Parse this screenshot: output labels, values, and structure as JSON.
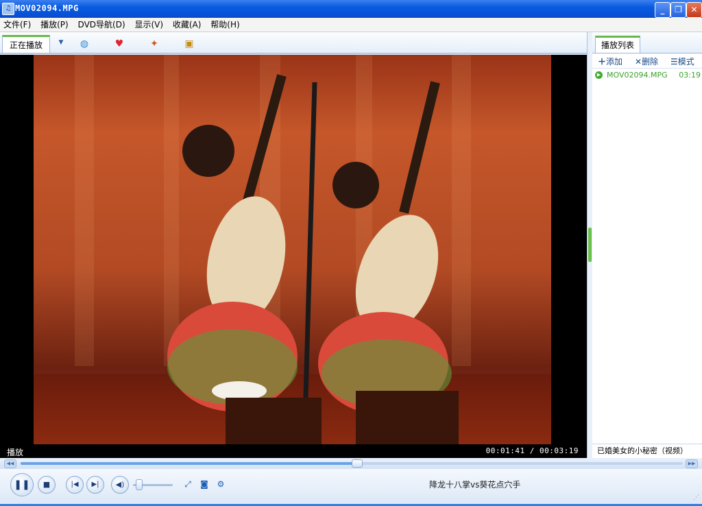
{
  "window": {
    "title": "MOV02094.MPG",
    "buttons": {
      "minimize": "_",
      "restore": "❐",
      "close": "✕"
    }
  },
  "menu": {
    "items": [
      "文件(F)",
      "播放(P)",
      "DVD导航(D)",
      "显示(V)",
      "收藏(A)",
      "帮助(H)"
    ]
  },
  "tabs": {
    "active": "正在播放",
    "icons": [
      "headphones-icon",
      "heart-icon",
      "game-icon",
      "video-icon"
    ]
  },
  "status": {
    "state": "播放",
    "time": "00:01:41 / 00:03:19"
  },
  "playlist": {
    "tab": "播放列表",
    "tools": {
      "add": "添加",
      "delete": "删除",
      "mode": "模式"
    },
    "items": [
      {
        "name": "MOV02094.MPG",
        "duration": "03:19"
      }
    ],
    "bottom_text": "已婚美女的小秘密（视频）"
  },
  "playback": {
    "progress": 0.507,
    "volume": 0.1,
    "now_playing": "降龙十八掌vs葵花点穴手"
  },
  "colors": {
    "accent": "#0652d8",
    "tab_highlight": "#67b84a",
    "playlist_item": "#3ba12a"
  }
}
